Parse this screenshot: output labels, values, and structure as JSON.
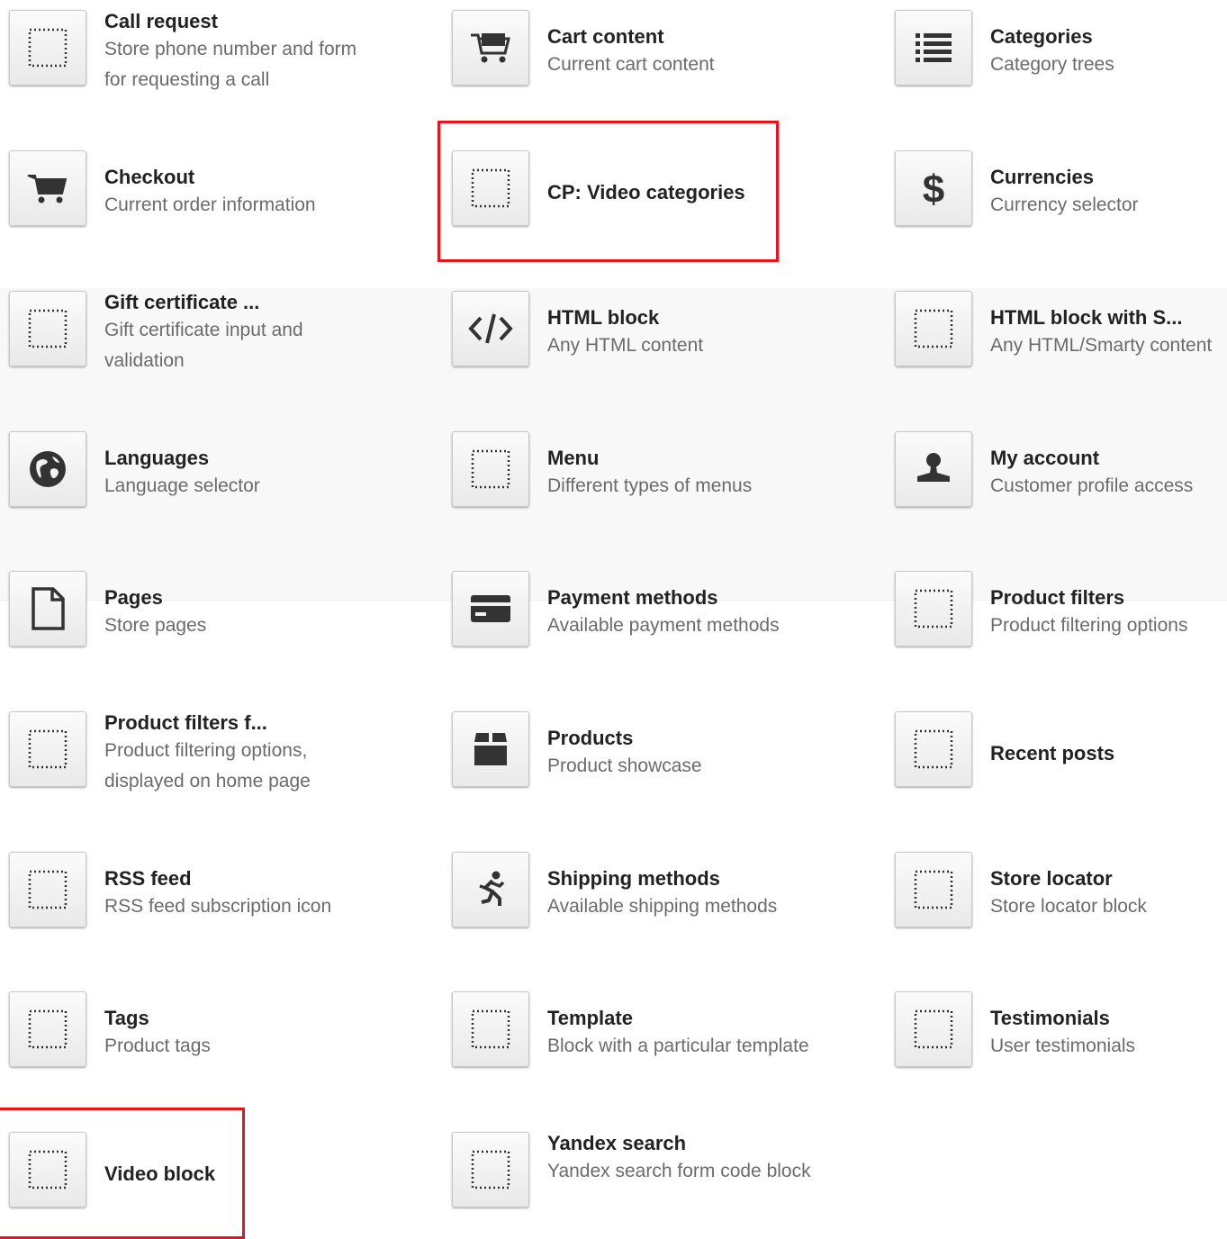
{
  "blocks": {
    "call_request": {
      "title": "Call request",
      "desc": "Store phone number and form for requesting a call",
      "icon": "dotted-square-icon"
    },
    "cart_content": {
      "title": "Cart content",
      "desc": "Current cart content",
      "icon": "cart-full-icon"
    },
    "categories": {
      "title": "Categories",
      "desc": "Category trees",
      "icon": "list-icon"
    },
    "checkout": {
      "title": "Checkout",
      "desc": "Current order information",
      "icon": "cart-icon"
    },
    "cp_video_categories": {
      "title": "CP: Video categories",
      "icon": "dotted-square-icon"
    },
    "currencies": {
      "title": "Currencies",
      "desc": "Currency selector",
      "icon": "dollar-icon"
    },
    "gift_certificate": {
      "title": "Gift certificate ...",
      "desc": "Gift certificate input and validation",
      "icon": "dotted-square-icon"
    },
    "html_block": {
      "title": "HTML block",
      "desc": "Any HTML content",
      "icon": "code-icon"
    },
    "html_block_smarty": {
      "title": "HTML block with S...",
      "desc": "Any HTML/Smarty content",
      "icon": "dotted-square-icon"
    },
    "languages": {
      "title": "Languages",
      "desc": "Language selector",
      "icon": "globe-icon"
    },
    "menu": {
      "title": "Menu",
      "desc": "Different types of menus",
      "icon": "dotted-square-icon"
    },
    "my_account": {
      "title": "My account",
      "desc": "Customer profile access",
      "icon": "user-icon"
    },
    "pages": {
      "title": "Pages",
      "desc": "Store pages",
      "icon": "page-icon"
    },
    "payment_methods": {
      "title": "Payment methods",
      "desc": "Available payment methods",
      "icon": "credit-card-icon"
    },
    "product_filters": {
      "title": "Product filters",
      "desc": "Product filtering options",
      "icon": "dotted-square-icon"
    },
    "product_filters_home": {
      "title": "Product filters f...",
      "desc": "Product filtering options, displayed on home page",
      "icon": "dotted-square-icon"
    },
    "products": {
      "title": "Products",
      "desc": "Product showcase",
      "icon": "box-icon"
    },
    "recent_posts": {
      "title": "Recent posts",
      "icon": "dotted-square-icon"
    },
    "rss_feed": {
      "title": "RSS feed",
      "desc": "RSS feed subscription icon",
      "icon": "dotted-square-icon"
    },
    "shipping_methods": {
      "title": "Shipping methods",
      "desc": "Available shipping methods",
      "icon": "runner-icon"
    },
    "store_locator": {
      "title": "Store locator",
      "desc": "Store locator block",
      "icon": "dotted-square-icon"
    },
    "tags": {
      "title": "Tags",
      "desc": "Product tags",
      "icon": "dotted-square-icon"
    },
    "template": {
      "title": "Template",
      "desc": "Block with a particular template",
      "icon": "dotted-square-icon"
    },
    "testimonials": {
      "title": "Testimonials",
      "desc": "User testimonials",
      "icon": "dotted-square-icon"
    },
    "video_block": {
      "title": "Video block",
      "icon": "dotted-square-icon"
    },
    "yandex_search": {
      "title": "Yandex search",
      "desc": "Yandex search form code block",
      "icon": "dotted-square-icon"
    }
  },
  "colors": {
    "highlight": "#e8141b",
    "title": "#222222",
    "description": "#6b6b6b",
    "icon": "#333333"
  }
}
